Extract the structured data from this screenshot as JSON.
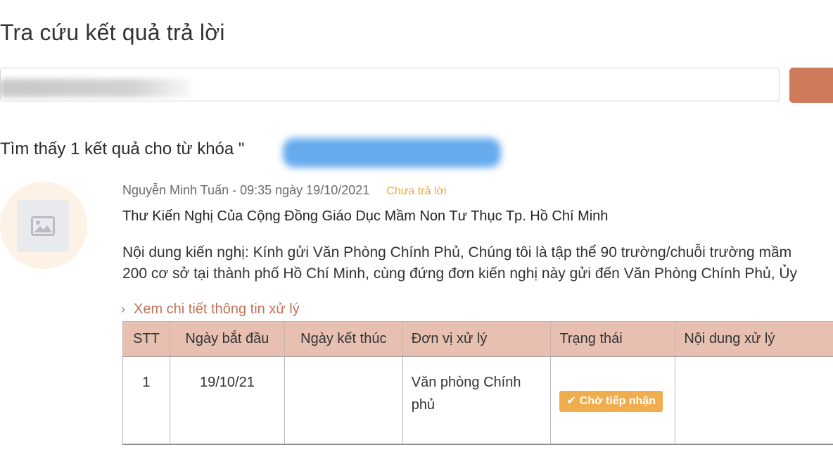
{
  "page": {
    "title": "Tra cứu kết quả trả lời"
  },
  "search": {
    "value": "",
    "button_label": ""
  },
  "results": {
    "summary_prefix": "Tìm thấy 1 kết quả cho từ khóa \""
  },
  "petition": {
    "meta": "Nguyễn Minh Tuấn - 09:35 ngày 19/10/2021",
    "status": "Chưa trả lời",
    "title": "Thư Kiến Nghị Của Cộng Đồng Giáo Dục Mầm Non Tư Thục Tp. Hồ Chí Minh",
    "content_line1": "Nội dung kiến nghị: Kính gửi Văn Phòng Chính Phủ, Chúng tôi là tập thể 90 trường/chuỗi trường mầm",
    "content_line2": "200 cơ sở tại thành phố Hồ Chí Minh, cùng đứng đơn kiến nghị này gửi đến Văn Phòng Chính Phủ, Ủy",
    "detail_link": "Xem chi tiết thông tin xử lý"
  },
  "table": {
    "headers": [
      "STT",
      "Ngày bắt đầu",
      "Ngày kết thúc",
      "Đơn vị xử lý",
      "Trạng thái",
      "Nội dung xử lý"
    ],
    "rows": [
      {
        "stt": "1",
        "start": "19/10/21",
        "end": "",
        "unit": "Văn phòng Chính phủ",
        "status": "Chờ tiếp nhận",
        "content": ""
      }
    ]
  },
  "colors": {
    "accent": "#cf7a5a",
    "table_header": "#e7c0b2",
    "pending_badge": "#f0ad4e",
    "unanswered_status": "#f0a830",
    "link": "#c0745a"
  },
  "icons": {
    "avatar_placeholder": "image-placeholder-icon",
    "detail_link": "chevron-right-icon",
    "status_badge": "check-icon"
  }
}
